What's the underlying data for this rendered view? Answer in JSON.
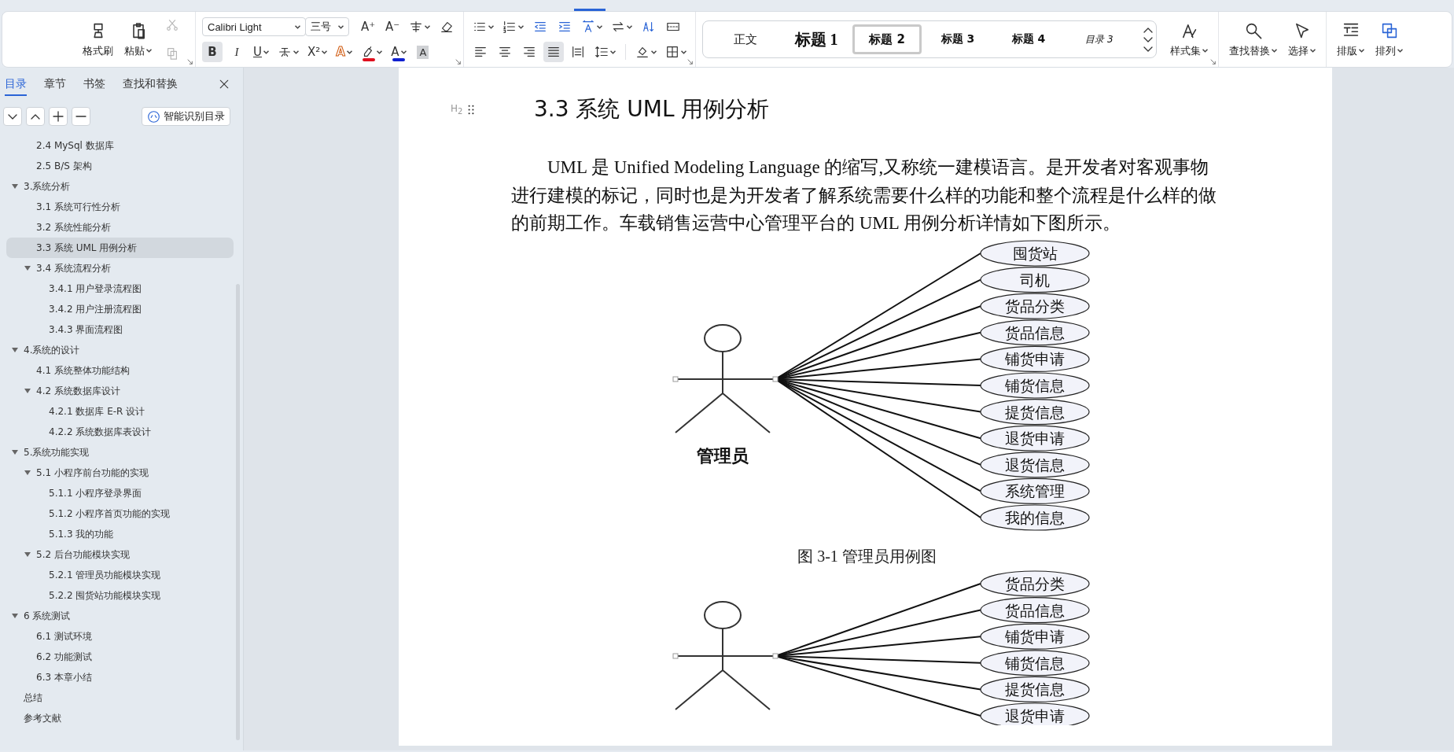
{
  "ribbon": {
    "clipboard": {
      "buttons": [
        "格式刷",
        "粘贴"
      ],
      "small_buttons": [
        {
          "disabled": true
        },
        {
          "disabled": true
        }
      ]
    },
    "font": {
      "font_name": "Calibri Light",
      "font_size": "三号",
      "size_buttons": [
        "A⁺",
        "A⁻"
      ],
      "format_buttons": [
        {
          "glyph": "B",
          "selected": true
        },
        {
          "glyph": "I",
          "selected": false
        },
        {
          "glyph": "U",
          "selected": false
        },
        {
          "selected": false
        },
        {
          "glyph": "X²",
          "selected": false
        },
        {
          "glyph": "A",
          "selected": false
        },
        {
          "selected": false,
          "color": "#e0101e"
        },
        {
          "glyph": "A",
          "selected": false,
          "color": "#1020d0"
        },
        {
          "glyph": "A",
          "selected": false
        }
      ]
    },
    "paragraph": {
      "alignment": [
        {
          "selected": false
        },
        {
          "selected": false
        },
        {
          "selected": false
        },
        {
          "selected": true
        },
        {
          "selected": false
        }
      ]
    },
    "styles": {
      "items": [
        {
          "kind": "body",
          "label": "正文",
          "selected": false
        },
        {
          "kind": "h1",
          "label": "标题 1",
          "selected": false
        },
        {
          "kind": "h2",
          "label": "标题 2",
          "selected": true
        },
        {
          "kind": "h3",
          "label": "标题 3",
          "selected": false
        },
        {
          "kind": "h4",
          "label": "标题 4",
          "selected": false
        },
        {
          "kind": "toc",
          "label": "目录 3",
          "selected": false
        }
      ],
      "style_set": "样式集"
    },
    "find": [
      "查找替换",
      "选择"
    ],
    "layout": [
      "排版",
      "排列"
    ]
  },
  "sidebar": {
    "tabs": [
      {
        "label": "目录",
        "selected": true
      },
      {
        "label": "章节",
        "selected": false
      },
      {
        "label": "书签",
        "selected": false
      },
      {
        "label": "查找和替换",
        "selected": false
      }
    ],
    "smart_button": "智能识别目录",
    "outline": [
      {
        "children": [
          {
            "label": "2.4 MySql 数据库",
            "selected": false
          },
          {
            "label": "2.5 B/S 架构",
            "selected": false
          }
        ]
      },
      {
        "label": "3.系统分析",
        "selected": false,
        "expanded": true,
        "children": [
          {
            "label": "3.1  系统可行性分析",
            "selected": false
          },
          {
            "label": "3.2  系统性能分析",
            "selected": false
          },
          {
            "label": "3.3 系统 UML 用例分析",
            "selected": true
          },
          {
            "label": "3.4  系统流程分析",
            "selected": false,
            "expanded": true,
            "children": [
              {
                "label": "3.4.1  用户登录流程图",
                "selected": false
              },
              {
                "label": "3.4.2  用户注册流程图",
                "selected": false
              },
              {
                "label": "3.4.3  界面流程图",
                "selected": false
              }
            ]
          }
        ]
      },
      {
        "label": "4.系统的设计",
        "selected": false,
        "expanded": true,
        "children": [
          {
            "label": "4.1  系统整体功能结构",
            "selected": false
          },
          {
            "label": "4.2  系统数据库设计",
            "selected": false,
            "expanded": true,
            "children": [
              {
                "label": "4.2.1 数据库 E-R 设计",
                "selected": false
              },
              {
                "label": "4.2.2  系统数据库表设计",
                "selected": false
              }
            ]
          }
        ]
      },
      {
        "label": "5.系统功能实现",
        "selected": false,
        "expanded": true,
        "children": [
          {
            "label": "5.1 小程序前台功能的实现",
            "selected": false,
            "expanded": true,
            "children": [
              {
                "label": "5.1.1 小程序登录界面",
                "selected": false
              },
              {
                "label": "5.1.2 小程序首页功能的实现",
                "selected": false
              },
              {
                "label": "5.1.3 我的功能",
                "selected": false
              }
            ]
          },
          {
            "label": "5.2 后台功能模块实现",
            "selected": false,
            "expanded": true,
            "children": [
              {
                "label": "5.2.1 管理员功能模块实现",
                "selected": false
              },
              {
                "label": "5.2.2 囤货站功能模块实现",
                "selected": false
              }
            ]
          }
        ]
      },
      {
        "label": "6 系统测试",
        "selected": false,
        "expanded": true,
        "children": [
          {
            "label": "6.1 测试环境",
            "selected": false
          },
          {
            "label": "6.2 功能测试",
            "selected": false
          },
          {
            "label": "6.3  本章小结",
            "selected": false
          }
        ]
      },
      {
        "label": "总结",
        "selected": false
      },
      {
        "label": "参考文献",
        "selected": false
      }
    ]
  },
  "document": {
    "heading_marker": "H$_{2}$",
    "heading": "3.3 系统 UML 用例分析",
    "paragraph": "UML 是  Unified Modeling Language 的缩写,又称统一建模语言。是开发者对客观事物进行建模的标记，同时也是为开发者了解系统需要什么样的功能和整个流程是什么样的做的前期工作。车载销售运营中心管理平台的 UML 用例分析详情如下图所示。",
    "figures": [
      {
        "actor": "管理员",
        "use_cases": [
          "囤货站",
          "司机",
          "货品分类",
          "货品信息",
          "铺货申请",
          "铺货信息",
          "提货信息",
          "退货申请",
          "退货信息",
          "系统管理",
          "我的信息"
        ],
        "caption": "图 3-1 管理员用例图"
      },
      {
        "use_cases": [
          "货品分类",
          "货品信息",
          "铺货申请",
          "铺货信息",
          "提货信息",
          "退货申请"
        ]
      }
    ]
  }
}
